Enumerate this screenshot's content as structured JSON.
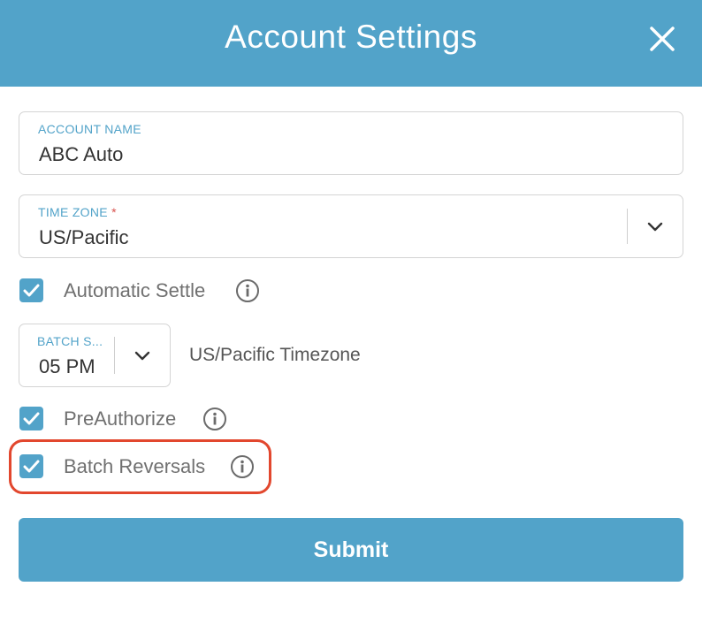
{
  "header": {
    "title": "Account Settings",
    "close_icon": "close-icon"
  },
  "account_name": {
    "label": "ACCOUNT NAME",
    "value": "ABC Auto"
  },
  "time_zone": {
    "label": "TIME ZONE",
    "required_mark": "*",
    "value": "US/Pacific",
    "dropdown_icon": "chevron-down-icon"
  },
  "automatic_settle": {
    "label": "Automatic Settle",
    "checked": true,
    "info_icon": "info-icon"
  },
  "batch_settle_time": {
    "label": "BATCH S...",
    "value": "05 PM",
    "dropdown_icon": "chevron-down-icon"
  },
  "timezone_note": "US/Pacific Timezone",
  "preauthorize": {
    "label": "PreAuthorize",
    "checked": true,
    "info_icon": "info-icon"
  },
  "batch_reversals": {
    "label": "Batch Reversals",
    "checked": true,
    "info_icon": "info-icon"
  },
  "submit": {
    "label": "Submit"
  },
  "colors": {
    "accent": "#52a3c9",
    "highlight": "#e2472e",
    "required": "#d9534f"
  }
}
